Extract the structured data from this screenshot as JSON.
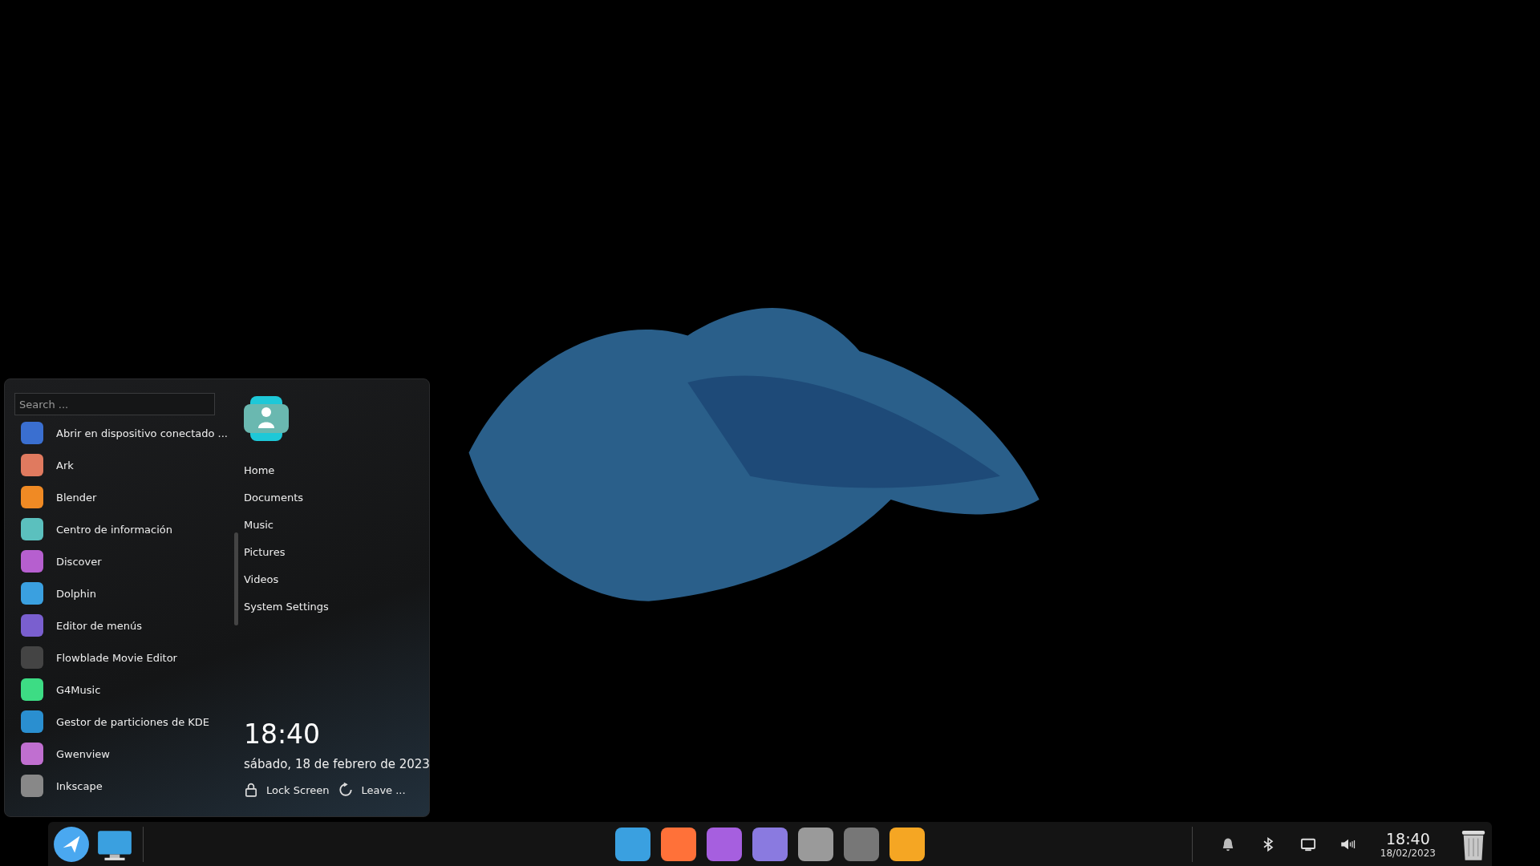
{
  "launcher": {
    "search": {
      "placeholder": "Search ..."
    },
    "apps": [
      {
        "name": "Abrir en dispositivo conectado ..."
      },
      {
        "name": "Ark"
      },
      {
        "name": "Blender"
      },
      {
        "name": "Centro de información"
      },
      {
        "name": "Discover"
      },
      {
        "name": "Dolphin"
      },
      {
        "name": "Editor de menús"
      },
      {
        "name": "Flowblade Movie Editor"
      },
      {
        "name": "G4Music"
      },
      {
        "name": "Gestor de particiones de KDE"
      },
      {
        "name": "Gwenview"
      },
      {
        "name": "Inkscape"
      }
    ],
    "places": [
      "Home",
      "Documents",
      "Music",
      "Pictures",
      "Videos",
      "System Settings"
    ],
    "clock": {
      "time": "18:40",
      "date": "sábado, 18 de febrero de 2023"
    },
    "actions": [
      {
        "kind": "lock",
        "label": "Lock Screen"
      },
      {
        "kind": "leave",
        "label": "Leave ..."
      }
    ]
  },
  "taskbar": {
    "clock": {
      "time": "18:40",
      "date": "18/02/2023"
    }
  }
}
